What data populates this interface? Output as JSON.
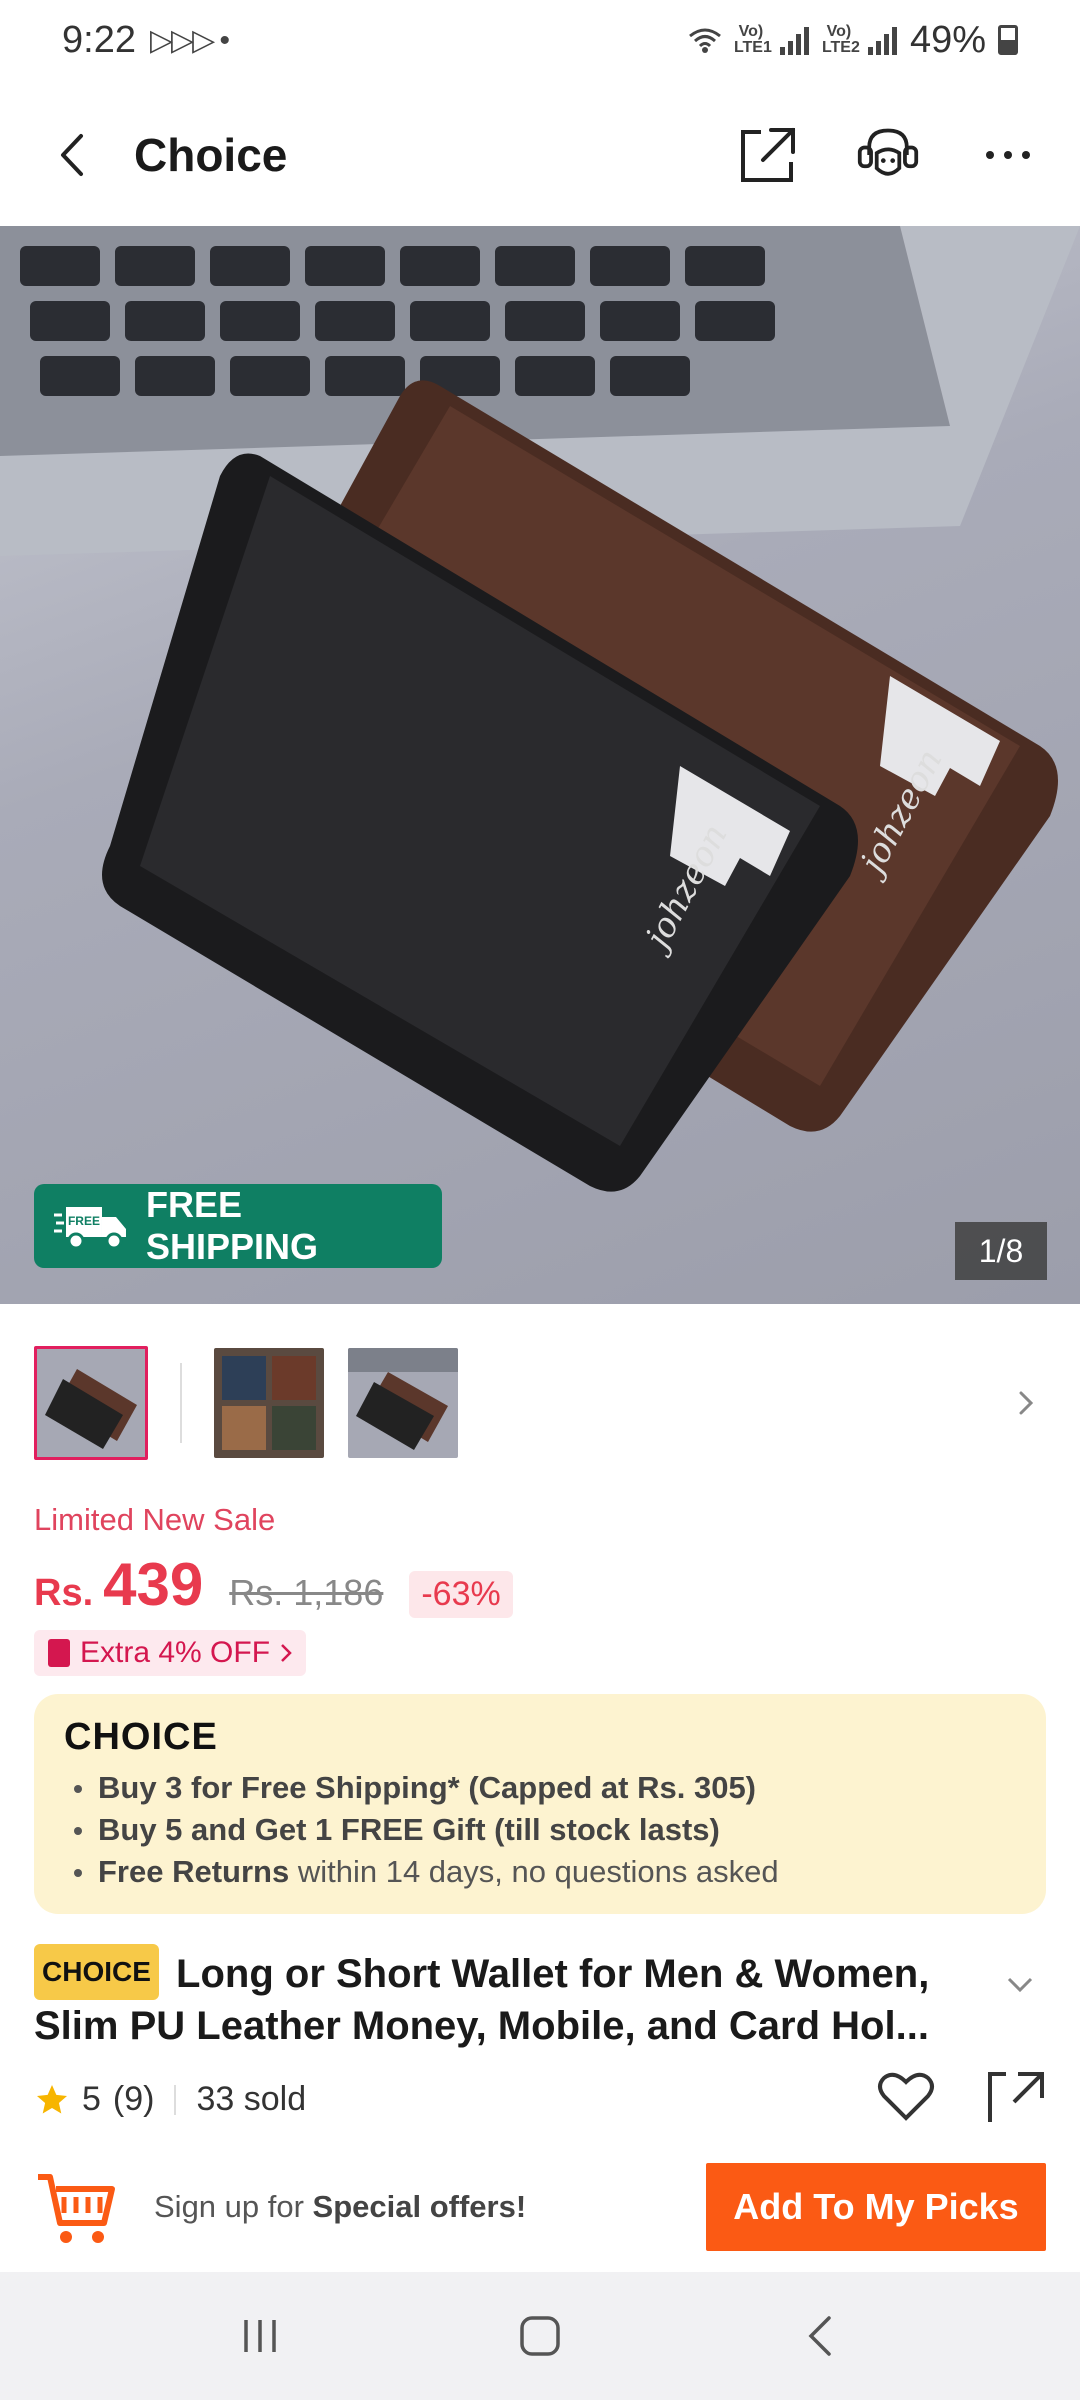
{
  "status_bar": {
    "time": "9:22",
    "notifications": "▷▷▷ •",
    "net1": "Vo) LTE1",
    "net2": "Vo) LTE2",
    "battery": "49%"
  },
  "header": {
    "title": "Choice",
    "icons": [
      "back-icon",
      "share-icon",
      "support-icon",
      "more-icon"
    ]
  },
  "hero": {
    "free_shipping_label": "FREE SHIPPING",
    "truck_label": "FREE",
    "image_counter": "1/8",
    "brand_mark": "johzeon"
  },
  "pricing": {
    "sale_label": "Limited New Sale",
    "currency": "Rs.",
    "price": "439",
    "original_price": "Rs. 1,186",
    "discount": "-63%",
    "extra_off": "Extra 4% OFF"
  },
  "choice": {
    "logo": "CHOICE",
    "line1": "Buy 3 for  Free Shipping* (Capped at Rs. 305)",
    "line2": "Buy 5 and Get 1 FREE Gift (till stock lasts)",
    "line3_bold": "Free Returns",
    "line3_rest": " within 14 days, no questions asked"
  },
  "product": {
    "badge": "CHOICE",
    "title": "Long or Short Wallet for Men & Women, Slim PU Leather Money, Mobile, and Card Hol..."
  },
  "rating": {
    "score": "5",
    "count": "(9)",
    "sold": "33 sold"
  },
  "action_bar": {
    "signup_prefix": "Sign up for ",
    "signup_bold": "Special offers!",
    "picks_button": "Add To My Picks"
  },
  "colors": {
    "accent_red": "#e83a4e",
    "shipping_green": "#0f7f63",
    "picks_orange": "#fb5a14",
    "choice_bg": "#fdf3d0"
  }
}
